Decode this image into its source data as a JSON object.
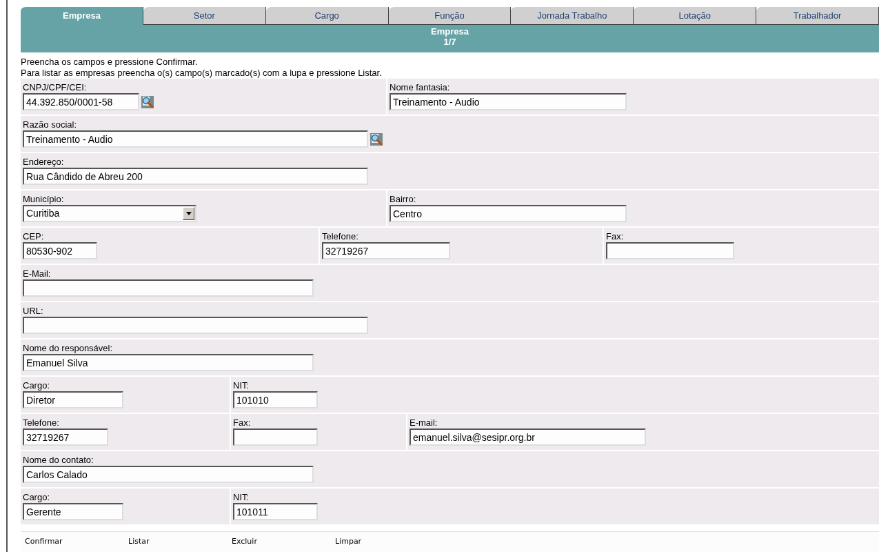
{
  "tabs": [
    {
      "label": "Empresa",
      "selected": true
    },
    {
      "label": "Setor",
      "selected": false
    },
    {
      "label": "Cargo",
      "selected": false
    },
    {
      "label": "Função",
      "selected": false
    },
    {
      "label": "Jornada Trabalho",
      "selected": false
    },
    {
      "label": "Lotação",
      "selected": false
    },
    {
      "label": "Trabalhador",
      "selected": false
    }
  ],
  "header": {
    "title": "Empresa",
    "step": "1/7"
  },
  "instructions": [
    "Preencha os campos e pressione Confirmar.",
    "Para listar as empresas preencha o(s) campo(s) marcado(s) com a lupa e pressione Listar."
  ],
  "rows": [
    {
      "fields": [
        {
          "kind": "text",
          "label": "CNPJ/CPF/CEI:",
          "value": "44.392.850/0001-58",
          "lookup": true
        },
        {
          "kind": "text",
          "label": "Nome fantasia:",
          "value": "Treinamento - Audio",
          "lookup": false
        }
      ]
    },
    {
      "fields": [
        {
          "kind": "text",
          "label": "Razão social:",
          "value": "Treinamento - Audio",
          "lookup": true
        }
      ]
    },
    {
      "fields": [
        {
          "kind": "text",
          "label": "Endereço:",
          "value": "Rua Cândido de Abreu 200",
          "lookup": false
        }
      ]
    },
    {
      "fields": [
        {
          "kind": "select",
          "label": "Município:",
          "value": "Curitiba",
          "lookup": false
        },
        {
          "kind": "text",
          "label": "Bairro:",
          "value": "Centro",
          "lookup": false
        }
      ]
    },
    {
      "fields": [
        {
          "kind": "text",
          "label": "CEP:",
          "value": "80530-902",
          "lookup": false
        },
        {
          "kind": "text",
          "label": "Telefone:",
          "value": "32719267",
          "lookup": false
        },
        {
          "kind": "text",
          "label": "Fax:",
          "lookup": false
        }
      ]
    },
    {
      "fields": [
        {
          "kind": "text",
          "label": "E-Mail:",
          "lookup": false
        }
      ]
    },
    {
      "fields": [
        {
          "kind": "text",
          "label": "URL:",
          "lookup": false
        }
      ]
    },
    {
      "fields": [
        {
          "kind": "text",
          "label": "Nome do responsável:",
          "value": "Emanuel Silva",
          "lookup": false
        }
      ]
    },
    {
      "fields": [
        {
          "kind": "text",
          "label": "Cargo:",
          "value": "Diretor",
          "lookup": false
        },
        {
          "kind": "text",
          "label": "NIT:",
          "value": "101010",
          "lookup": false
        }
      ]
    },
    {
      "fields": [
        {
          "kind": "text",
          "label": "Telefone:",
          "value": "32719267",
          "lookup": false
        },
        {
          "kind": "text",
          "label": "Fax:",
          "lookup": false
        },
        {
          "kind": "text",
          "label": "E-mail:",
          "value": "emanuel.silva@sesipr.org.br",
          "lookup": false
        }
      ]
    },
    {
      "fields": [
        {
          "kind": "text",
          "label": "Nome do contato:",
          "value": "Carlos Calado",
          "lookup": false
        }
      ]
    },
    {
      "fields": [
        {
          "kind": "text",
          "label": "Cargo:",
          "value": "Gerente",
          "lookup": false
        },
        {
          "kind": "text",
          "label": "NIT:",
          "value": "101011",
          "lookup": false
        }
      ]
    }
  ],
  "buttons": [
    "Confirmar",
    "Listar",
    "Excluir",
    "Limpar"
  ]
}
